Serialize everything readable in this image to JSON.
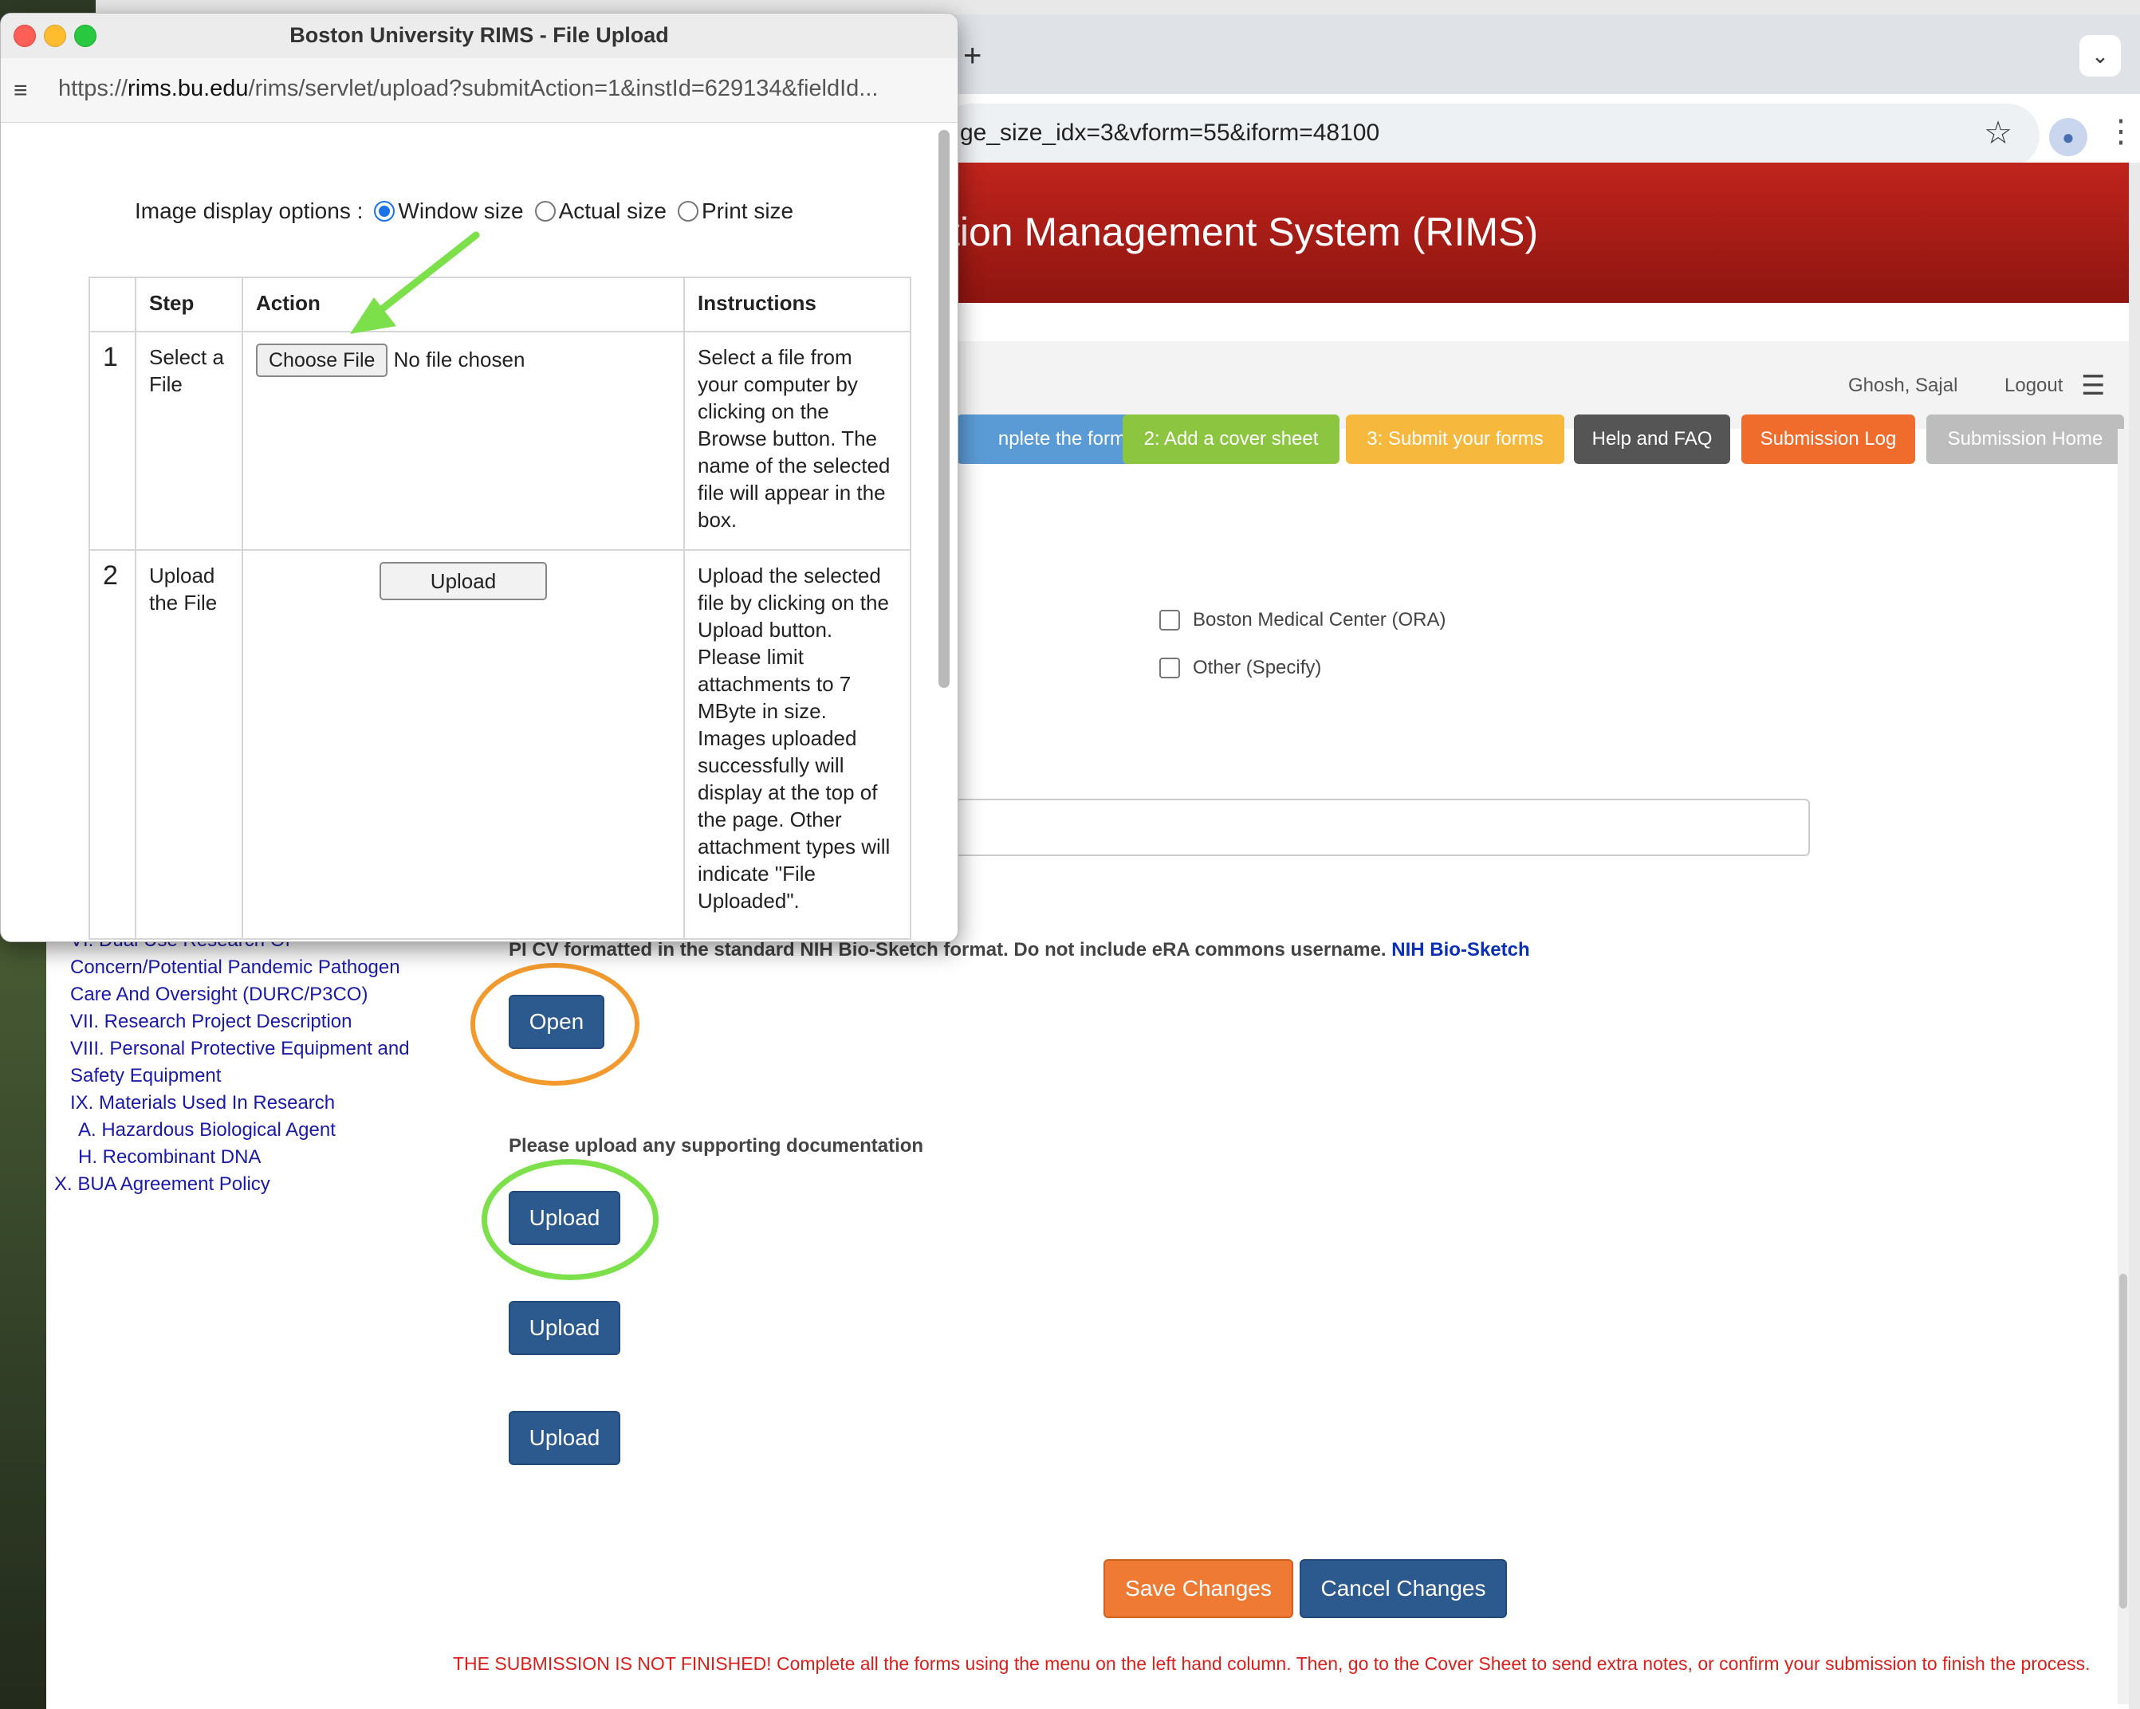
{
  "browser": {
    "new_tab_symbol": "+",
    "url_fragment": "ge_size_idx=3&vform=55&iform=48100",
    "banner_title": "tion Management System (RIMS)",
    "user_name": "Ghosh, Sajal",
    "logout_label": "Logout"
  },
  "nav_buttons": [
    {
      "label": "nplete the forms",
      "color": "#5b9bd5"
    },
    {
      "label": "2: Add a cover sheet",
      "color": "#8cc540"
    },
    {
      "label": "3: Submit your forms",
      "color": "#f6b83d"
    },
    {
      "label": "Help and FAQ",
      "color": "#555555"
    },
    {
      "label": "Submission Log",
      "color": "#ef6c2c"
    },
    {
      "label": "Submission Home",
      "color": "#bdbdbd"
    }
  ],
  "checkboxes": [
    {
      "label": "Boston Medical Center (ORA)",
      "checked": false
    },
    {
      "label": "Other (Specify)",
      "checked": false
    }
  ],
  "sidebar": {
    "items": [
      "VI. Dual Use Research Of",
      "Concern/Potential Pandemic Pathogen",
      "Care And Oversight (DURC/P3CO)",
      "VII. Research Project Description",
      "VIII. Personal Protective Equipment and",
      "Safety Equipment",
      "IX. Materials Used In Research",
      "A. Hazardous Biological Agent",
      "H. Recombinant DNA",
      "X. BUA Agreement Policy"
    ]
  },
  "main": {
    "cv_label": "PI CV formatted in the standard NIH Bio-Sketch format. Do not include eRA commons username.",
    "nih_link": "NIH Bio-Sketch",
    "open_label": "Open",
    "supporting_label": "Please upload any supporting documentation",
    "upload_label": "Upload",
    "save_label": "Save Changes",
    "cancel_label": "Cancel Changes",
    "warning": "THE SUBMISSION IS NOT FINISHED! Complete all the forms using the menu on the left hand column. Then, go to the Cover Sheet to send extra notes, or confirm your submission to finish the process."
  },
  "popup": {
    "title": "Boston University RIMS - File Upload",
    "url_scheme": "https://",
    "url_host": "rims.bu.edu",
    "url_path": "/rims/servlet/upload?submitAction=1&instId=629134&fieldId...",
    "options_label": "Image display options :",
    "options": [
      {
        "label": "Window size",
        "selected": true
      },
      {
        "label": "Actual size",
        "selected": false
      },
      {
        "label": "Print size",
        "selected": false
      }
    ],
    "table": {
      "headers": [
        "",
        "Step",
        "Action",
        "Instructions"
      ],
      "rows": [
        {
          "num": "1",
          "step": "Select a File",
          "action_button": "Choose File",
          "action_text": "No file chosen",
          "instructions": "Select a file from your computer by clicking on the Browse button. The name of the selected file will appear in the box."
        },
        {
          "num": "2",
          "step": "Upload the File",
          "action_button": "Upload",
          "instructions": "Upload the selected file by clicking on the Upload button. Please limit attachments to 7 MByte in size. Images uploaded successfully will display at the top of the page. Other attachment types will indicate \"File Uploaded\"."
        }
      ]
    }
  },
  "annotations": {
    "arrow_color": "#7be04a",
    "orange_ring_color": "#f29a2e",
    "green_ring_color": "#7be04a"
  }
}
